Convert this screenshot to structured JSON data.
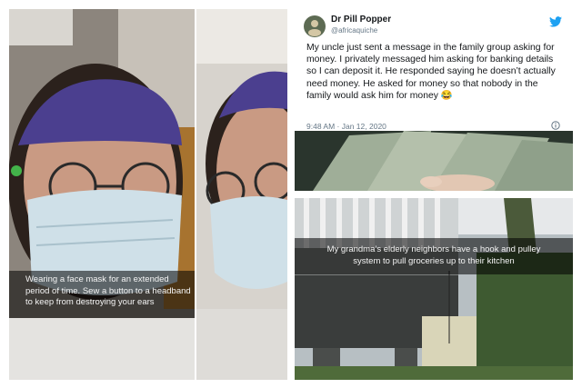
{
  "panels": {
    "mask": {
      "caption": [
        "Wearing a face mask for an extended",
        "period of time. Sew a button to a headband",
        "to keep from destroying your ears"
      ]
    },
    "tweet": {
      "name": "Dr Pill Popper",
      "handle": "@africaquiche",
      "body": "My uncle just sent a message in the family group asking for money. I privately messaged him asking for banking details so I can deposit it. He responded saying he doesn’t actually need money. He asked for money so that nobody in the family would ask him for money 😂",
      "time": "9:48 AM · Jan 12, 2020"
    },
    "pulley": {
      "caption": [
        "My grandma’s elderly neighbors have a hook and pulley",
        "system to pull groceries up to their kitchen"
      ]
    }
  },
  "colors": {
    "twitter_blue": "#1da1f2",
    "cap_purple": "#5a4a8a",
    "mask_blue": "#cfe0e8"
  },
  "icons": [
    "twitter-bird-icon",
    "info-icon"
  ]
}
